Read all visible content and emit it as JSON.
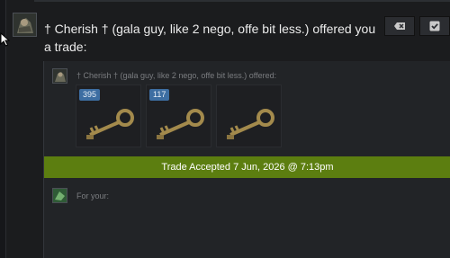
{
  "offer": {
    "headline": "† Cherish † (gala guy, like 2 nego, offe bit less.) offered you a trade:",
    "sub_line": "† Cherish † (gala guy, like 2 nego, offe bit less.) offered:",
    "items": [
      {
        "name": "key",
        "qty": "395"
      },
      {
        "name": "key",
        "qty": "117"
      },
      {
        "name": "key",
        "qty": ""
      }
    ],
    "status": "Trade Accepted 7 Jun, 2026 @ 7:13pm",
    "receive_label": "For your:"
  },
  "icons": {
    "decline": "tag-remove-icon",
    "accept": "checkbox-icon",
    "item": "key-icon"
  },
  "colors": {
    "accepted_bar": "#5c7e10",
    "qty_badge": "#3d6ea2"
  }
}
